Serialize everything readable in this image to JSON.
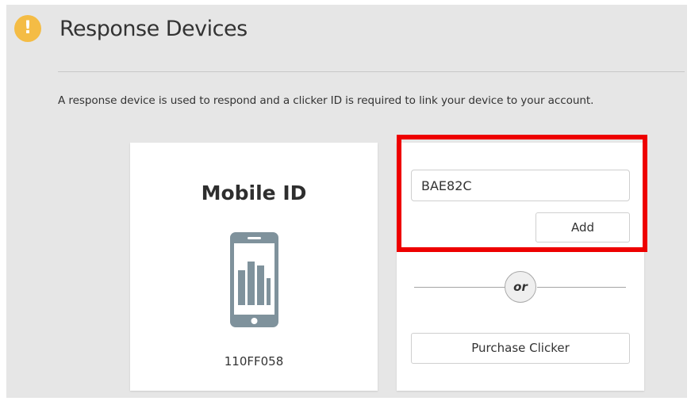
{
  "header": {
    "alert_icon": "exclamation-icon",
    "alert_symbol": "!",
    "title": "Response Devices"
  },
  "description": "A response device is used to respond and a clicker ID is required to link your device to your account.",
  "mobile_card": {
    "title": "Mobile ID",
    "icon": "phone-icon",
    "mobile_id": "110FF058"
  },
  "clicker_card": {
    "input_value": "BAE82C",
    "add_label": "Add",
    "separator_label": "or",
    "purchase_label": "Purchase Clicker"
  },
  "colors": {
    "alert": "#f4bc45",
    "highlight": "#ee0000",
    "phone": "#7f929c",
    "panel_bg": "#e6e6e6"
  }
}
